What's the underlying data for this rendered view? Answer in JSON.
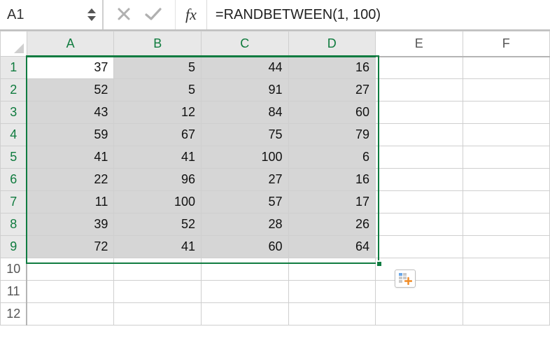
{
  "formula_bar": {
    "name_box": "A1",
    "fx_label": "fx",
    "formula": "=RANDBETWEEN(1, 100)"
  },
  "columns": [
    "A",
    "B",
    "C",
    "D",
    "E",
    "F"
  ],
  "rows": [
    "1",
    "2",
    "3",
    "4",
    "5",
    "6",
    "7",
    "8",
    "9",
    "10",
    "11",
    "12"
  ],
  "selected_cols": [
    "A",
    "B",
    "C",
    "D"
  ],
  "selected_rows": [
    "1",
    "2",
    "3",
    "4",
    "5",
    "6",
    "7",
    "8",
    "9"
  ],
  "active_cell": "A1",
  "chart_data": {
    "type": "table",
    "columns": [
      "A",
      "B",
      "C",
      "D"
    ],
    "rows": [
      [
        37,
        5,
        44,
        16
      ],
      [
        52,
        5,
        91,
        27
      ],
      [
        43,
        12,
        84,
        60
      ],
      [
        59,
        67,
        75,
        79
      ],
      [
        41,
        41,
        100,
        6
      ],
      [
        22,
        96,
        27,
        16
      ],
      [
        11,
        100,
        57,
        17
      ],
      [
        39,
        52,
        28,
        26
      ],
      [
        72,
        41,
        60,
        64
      ]
    ]
  },
  "colors": {
    "selection": "#107c41"
  }
}
